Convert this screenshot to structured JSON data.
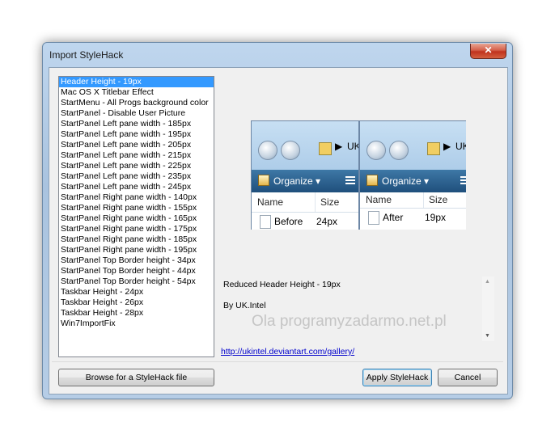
{
  "window": {
    "title": "Import StyleHack",
    "close_glyph": "✕"
  },
  "stylehacks": [
    "Header Height - 19px",
    "Mac OS X Titlebar Effect",
    "StartMenu - All Progs background color",
    "StartPanel - Disable User Picture",
    "StartPanel Left pane width - 185px",
    "StartPanel Left pane width - 195px",
    "StartPanel Left pane width - 205px",
    "StartPanel Left pane width - 215px",
    "StartPanel Left pane width - 225px",
    "StartPanel Left pane width - 235px",
    "StartPanel Left pane width - 245px",
    "StartPanel Right pane width - 140px",
    "StartPanel Right pane width - 155px",
    "StartPanel Right pane width - 165px",
    "StartPanel Right pane width - 175px",
    "StartPanel Right pane width - 185px",
    "StartPanel Right pane width - 195px",
    "StartPanel Top Border height - 34px",
    "StartPanel Top Border height - 44px",
    "StartPanel Top Border height - 54px",
    "Taskbar Height - 24px",
    "Taskbar Height - 26px",
    "Taskbar Height - 28px",
    "Win7ImportFix"
  ],
  "selected_index": 0,
  "preview": {
    "before": {
      "address": "UK",
      "organize": "Organize ▾",
      "col_name": "Name",
      "col_size": "Size",
      "file": "Before",
      "size": "24px"
    },
    "after": {
      "address": "UK",
      "organize": "Organize ▾",
      "col_name": "Name",
      "col_size": "Size",
      "file": "After",
      "size": "19px"
    }
  },
  "description": {
    "line1": "Reduced Header Height - 19px",
    "line2": "By UK.Intel",
    "watermark": "Ola programyzadarmo.net.pl"
  },
  "link": "http://ukintel.deviantart.com/gallery/",
  "buttons": {
    "browse": "Browse for a StyleHack file",
    "apply": "Apply StyleHack",
    "cancel": "Cancel"
  }
}
